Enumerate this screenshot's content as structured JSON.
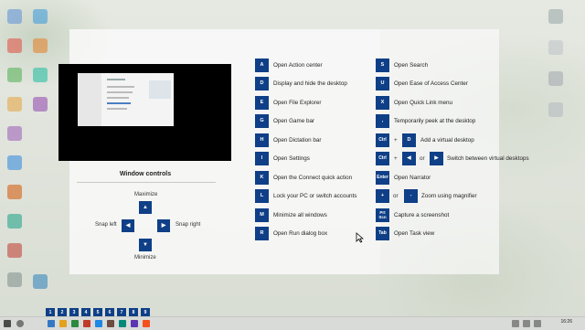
{
  "window_controls": {
    "title": "Window controls",
    "maximize": "Maximize",
    "minimize": "Minimize",
    "snap_left": "Snap left",
    "snap_right": "Snap right",
    "up_key": "▲",
    "down_key": "▼",
    "left_key": "◀",
    "right_key": "▶"
  },
  "shortcuts_left": [
    {
      "key": "A",
      "label": "Open Action center"
    },
    {
      "key": "D",
      "label": "Display and hide the desktop"
    },
    {
      "key": "E",
      "label": "Open File Explorer"
    },
    {
      "key": "G",
      "label": "Open Game bar"
    },
    {
      "key": "H",
      "label": "Open Dictation bar"
    },
    {
      "key": "I",
      "label": "Open Settings"
    },
    {
      "key": "K",
      "label": "Open the Connect quick action"
    },
    {
      "key": "L",
      "label": "Lock your PC or switch accounts"
    },
    {
      "key": "M",
      "label": "Minimize all windows"
    },
    {
      "key": "R",
      "label": "Open Run dialog box"
    }
  ],
  "shortcuts_right": [
    {
      "key": "S",
      "label": "Open Search"
    },
    {
      "key": "U",
      "label": "Open Ease of Access Center"
    },
    {
      "key": "X",
      "label": "Open Quick Link menu"
    },
    {
      "key": ",",
      "label": "Temporarily peek at the desktop"
    },
    {
      "key": "Ctrl",
      "key2": "D",
      "sep": "+",
      "label": "Add a virtual desktop"
    },
    {
      "key": "Ctrl",
      "key2": "◀",
      "key3": "▶",
      "sep": "+",
      "sep2": "or",
      "label": "Switch between virtual desktops"
    },
    {
      "key": "Enter",
      "label": "Open Narrator"
    },
    {
      "key": "+",
      "key2": "-",
      "sep": "or",
      "label": "Zoom using magnifier"
    },
    {
      "key": "Prt Scn",
      "label": "Capture a screenshot"
    },
    {
      "key": "Tab",
      "label": "Open Task view"
    }
  ],
  "taskbar_numbers": [
    "1",
    "2",
    "3",
    "4",
    "5",
    "6",
    "7",
    "8",
    "9"
  ],
  "colors": {
    "key_bg": "#0f3f87",
    "key_fg": "#ffffff"
  },
  "clock": "16:26"
}
